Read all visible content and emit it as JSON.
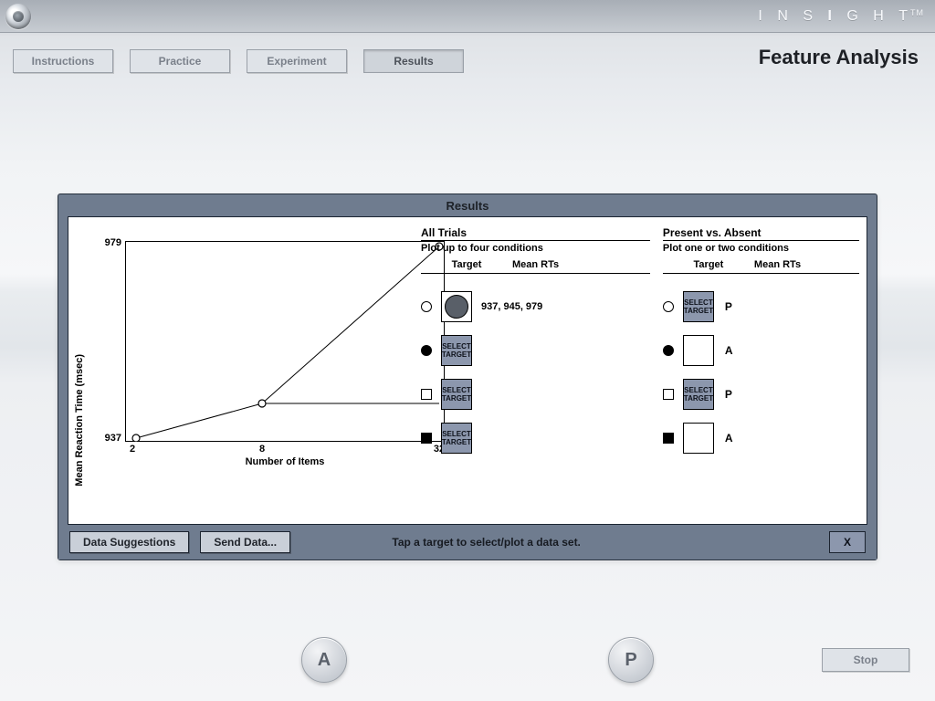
{
  "brand": {
    "name": "iNSIGHT",
    "tm": "TM"
  },
  "tabs": {
    "instructions": "Instructions",
    "practice": "Practice",
    "experiment": "Experiment",
    "results": "Results"
  },
  "page_title": "Feature Analysis",
  "panel": {
    "title": "Results",
    "hint": "Tap a target to select/plot a data set.",
    "buttons": {
      "suggestions": "Data Suggestions",
      "send": "Send Data...",
      "close": "X"
    }
  },
  "chart": {
    "ylabel": "Mean Reaction Time (msec)",
    "xlabel": "Number of Items",
    "xticks": [
      "2",
      "8",
      "32"
    ],
    "ymin_label": "937",
    "ymax_label": "979"
  },
  "chart_data": {
    "type": "line",
    "title": "",
    "xlabel": "Number of Items",
    "ylabel": "Mean Reaction Time (msec)",
    "x": [
      2,
      8,
      32
    ],
    "values": [
      937,
      945,
      979
    ],
    "ylim": [
      937,
      979
    ],
    "categories": [
      "2",
      "8",
      "32"
    ]
  },
  "all_trials": {
    "title": "All Trials",
    "subtitle": "Plot up to four conditions",
    "head_target": "Target",
    "head_rt": "Mean RTs",
    "select_label": "SELECT TARGET",
    "rows": [
      {
        "rts": "937, 945, 979"
      },
      {
        "rts": ""
      },
      {
        "rts": ""
      },
      {
        "rts": ""
      }
    ]
  },
  "pvsa": {
    "title": "Present vs. Absent",
    "subtitle": "Plot one or two conditions",
    "head_target": "Target",
    "head_rt": "Mean RTs",
    "select_label": "SELECT TARGET",
    "labels": {
      "p": "P",
      "a": "A"
    }
  },
  "bottom": {
    "a": "A",
    "p": "P",
    "stop": "Stop"
  }
}
